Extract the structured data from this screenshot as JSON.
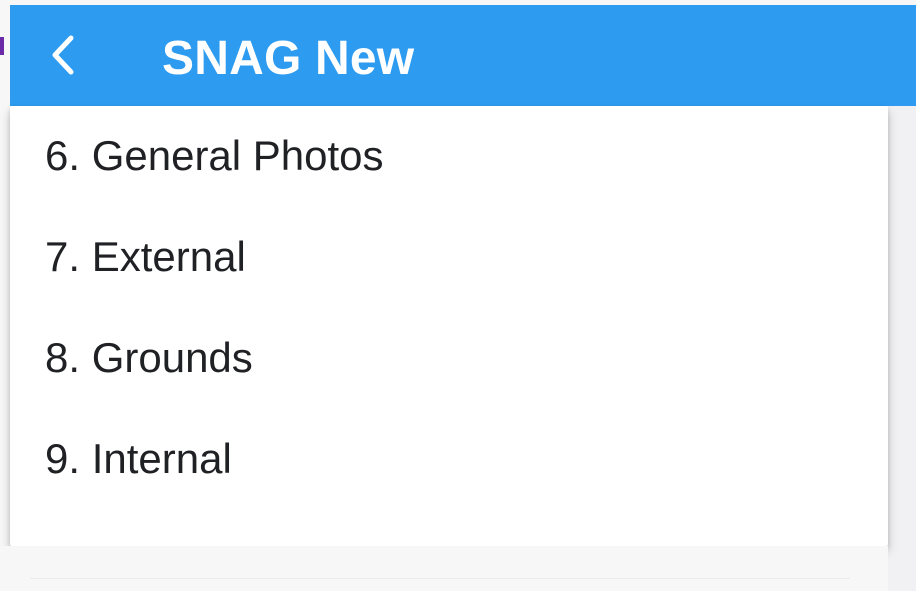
{
  "app_bar": {
    "title": "SNAG New",
    "back_icon": "chevron-left-icon",
    "background_color": "#2d9bf0"
  },
  "menu": {
    "items": [
      {
        "label": "6. General Photos"
      },
      {
        "label": "7. External"
      },
      {
        "label": "8. Grounds"
      },
      {
        "label": "9. Internal"
      }
    ]
  }
}
